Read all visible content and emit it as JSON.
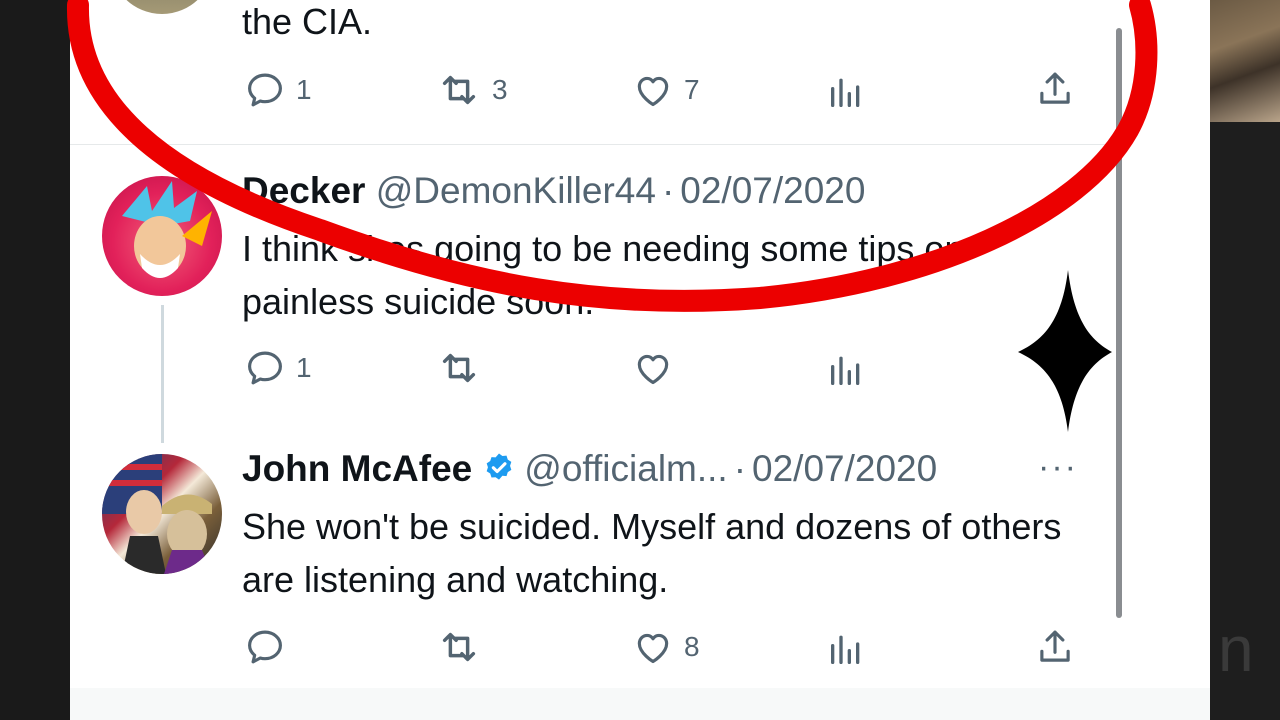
{
  "top_tweet": {
    "text_tail": "the CIA.",
    "replies": "1",
    "retweets": "3",
    "likes": "7"
  },
  "reply_1": {
    "display_name": "Decker",
    "handle": "@DemonKiller44",
    "separator": "·",
    "date": "02/07/2020",
    "text": "I think shes going to be needing some tips on painless suicide soon.",
    "replies": "1",
    "retweets": "",
    "likes": ""
  },
  "reply_2": {
    "display_name": "John McAfee",
    "verified": true,
    "handle": "@officialm...",
    "separator": "·",
    "date": "02/07/2020",
    "more_label": "···",
    "text": "She won't be suicided. Myself and dozens of others are listening and watching.",
    "replies": "",
    "retweets": "",
    "likes": "8"
  },
  "overlay": {
    "annotation_color": "#ec0000",
    "marker_color": "#000000"
  },
  "side_panel": {
    "glyph": "n"
  },
  "colors": {
    "text": "#0f1419",
    "secondary": "#536471",
    "verified": "#1d9bf0",
    "divider": "#e6e9ea"
  },
  "icons": [
    "reply-icon",
    "retweet-icon",
    "like-icon",
    "views-icon",
    "share-icon",
    "verified-badge-icon",
    "more-icon"
  ]
}
